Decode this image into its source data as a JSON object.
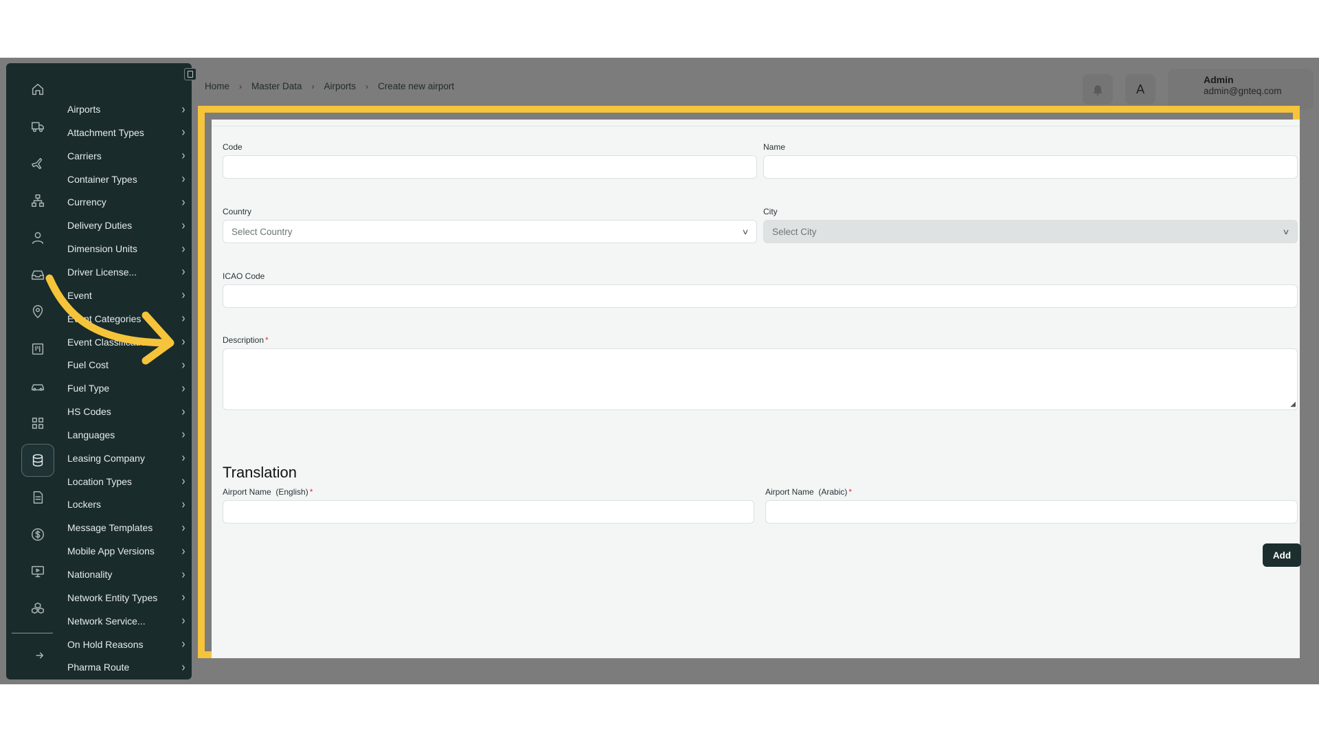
{
  "sidebar": {
    "rail_icons": [
      "home-icon",
      "truck-icon",
      "plane-icon",
      "network-icon",
      "user-icon",
      "inbox-icon",
      "location-icon",
      "kanban-icon",
      "car-icon",
      "grid-icon",
      "database-icon",
      "document-icon",
      "dollar-icon",
      "monitor-icon",
      "boxes-icon",
      "logout-icon"
    ],
    "items": [
      {
        "label": "Airports"
      },
      {
        "label": "Attachment Types"
      },
      {
        "label": "Carriers"
      },
      {
        "label": "Container Types"
      },
      {
        "label": "Currency"
      },
      {
        "label": "Delivery Duties"
      },
      {
        "label": "Dimension Units"
      },
      {
        "label": "Driver License..."
      },
      {
        "label": "Event"
      },
      {
        "label": "Event Categories"
      },
      {
        "label": "Event Classifications"
      },
      {
        "label": "Fuel Cost"
      },
      {
        "label": "Fuel Type"
      },
      {
        "label": "HS Codes"
      },
      {
        "label": "Languages"
      },
      {
        "label": "Leasing Company"
      },
      {
        "label": "Location Types"
      },
      {
        "label": "Lockers"
      },
      {
        "label": "Message Templates"
      },
      {
        "label": "Mobile App Versions"
      },
      {
        "label": "Nationality"
      },
      {
        "label": "Network Entity Types"
      },
      {
        "label": "Network Service..."
      },
      {
        "label": "On Hold Reasons"
      },
      {
        "label": "Pharma Route"
      }
    ],
    "chevron": "›"
  },
  "breadcrumb": [
    "Home",
    "Master Data",
    "Airports",
    "Create new airport"
  ],
  "breadcrumb_sep": "›",
  "header": {
    "notification_icon": "bell-icon",
    "language_icon": "translate-icon",
    "user_name": "Admin",
    "user_email": "admin@gnteq.com"
  },
  "form": {
    "code_label": "Code",
    "name_label": "Name",
    "country_label": "Country",
    "country_placeholder": "Select Country",
    "city_label": "City",
    "city_placeholder": "Select City",
    "icao_label": "ICAO Code",
    "description_label": "Description",
    "required_mark": "*",
    "translation_title": "Translation",
    "airport_name_en_label": "Airport Name  (English)",
    "airport_name_ar_label": "Airport Name  (Arabic)",
    "add_button": "Add"
  },
  "colors": {
    "sidebar_bg": "#1a2b2c",
    "highlight": "#f5c43a",
    "button_bg": "#1c2e2e",
    "overlay": "#7c7c7c"
  }
}
